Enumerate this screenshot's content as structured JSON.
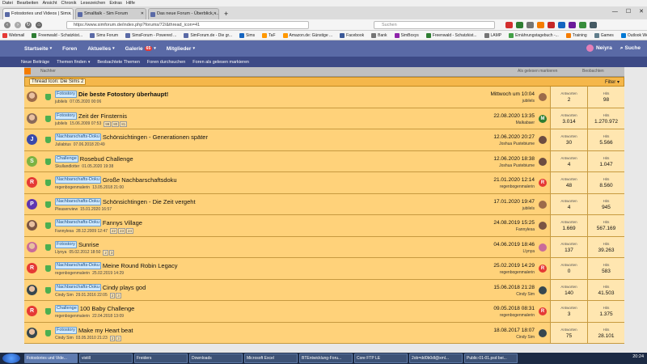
{
  "browser": {
    "menu": [
      "Datei",
      "Bearbeiten",
      "Ansicht",
      "Chronik",
      "Lesezeichen",
      "Extras",
      "Hilfe"
    ],
    "tabs": [
      {
        "label": "Fotostories und Videos | Sim...",
        "favicon_color": "#5a6aa6",
        "active": true
      },
      {
        "label": "Smalltalk - Sim Forum",
        "favicon_color": "#5a6aa6",
        "active": false
      },
      {
        "label": "Das neue Forum - Überblick, ...",
        "favicon_color": "#5a6aa6",
        "active": false
      }
    ],
    "url": "https://www.simforum.de/index.php?forums/72/&thread_icon=41",
    "search_placeholder": "Suchen",
    "addon_colors": [
      "#d32f2f",
      "#2e7d32",
      "#757575",
      "#f57c00",
      "#c62828",
      "#1565c0",
      "#6a1b9a",
      "#388e3c",
      "#455a64"
    ],
    "bookmarks": [
      {
        "label": "Webmail",
        "color": "#e53935"
      },
      {
        "label": "Freenwald - Schatzkist...",
        "color": "#2e7d32"
      },
      {
        "label": "Sims Forum",
        "color": "#5a6aa6"
      },
      {
        "label": "SimsForum - Powered ...",
        "color": "#5a6aa6"
      },
      {
        "label": "SimForum.de - Die gr...",
        "color": "#5a6aa6"
      },
      {
        "label": "Sims",
        "color": "#1565c0"
      },
      {
        "label": "TaF",
        "color": "#ff9800"
      },
      {
        "label": "Amazon.de: Günstige ...",
        "color": "#ff9800"
      },
      {
        "label": "Facebook",
        "color": "#3b5998"
      },
      {
        "label": "Bank",
        "color": "#757575"
      },
      {
        "label": "SimBoxys",
        "color": "#8e24aa"
      },
      {
        "label": "Freenwald - Schatzkist...",
        "color": "#2e7d32"
      },
      {
        "label": "LAMP",
        "color": "#757575"
      },
      {
        "label": "Ernährungstagebuch -...",
        "color": "#43a047"
      },
      {
        "label": "Training",
        "color": "#f57c00"
      },
      {
        "label": "Games",
        "color": "#607d8b"
      },
      {
        "label": "Outlook Web App",
        "color": "#0078d4"
      },
      {
        "label": "iGrad: Cashback, G...",
        "color": "#c62828"
      }
    ]
  },
  "site": {
    "nav": [
      {
        "label": "Startseite",
        "caret": true
      },
      {
        "label": "Foren",
        "caret": false
      },
      {
        "label": "Aktuelles",
        "caret": true
      },
      {
        "label": "Galerie",
        "caret": true,
        "badge": "65"
      },
      {
        "label": "Mitglieder",
        "caret": true
      }
    ],
    "username": "Neiyra",
    "search_label": "Suche",
    "subnav": [
      "Neue Beiträge",
      "Themen finden",
      "Beobachtete Themen",
      "Foren durchsuchen",
      "Foren als gelesen markieren"
    ],
    "partial_top": [
      "Nachher",
      "Als gelesen markieren",
      "Beobachten"
    ],
    "filter": {
      "tag": "Thread Icon: Die Sims 2",
      "label": "Filter"
    }
  },
  "threads": [
    {
      "avatar": "photo",
      "avatar_color": "#9c6b4a",
      "prefix": "Fotostory",
      "title": "Die beste Fotostory überhaupt!",
      "bold": true,
      "author": "jubilels",
      "date": "07.05.2020 00:06",
      "pages": [],
      "last_date": "Mittwoch um 10:04",
      "last_user": "jubilels",
      "last_av_color": "#9c6b4a",
      "replies": "2",
      "views": "98"
    },
    {
      "avatar": "photo",
      "avatar_color": "#8a6a5a",
      "prefix": "Fotostory",
      "title": "Zeit der Finsternis",
      "bold": false,
      "author": "jubilels",
      "date": "15.06.2009 07:53",
      "pages": [
        "99",
        "80",
        "81"
      ],
      "last_date": "22.08.2020 13:35",
      "last_user": "Malkabaer",
      "last_av_color": "#2e7d32",
      "last_av_letter": "M",
      "replies": "3.014",
      "views": "1.270.972"
    },
    {
      "avatar": "J",
      "avatar_color": "#3949ab",
      "prefix": "Nachbarschafts-Doku",
      "title": "Schönsichtingen - Generationen später",
      "bold": false,
      "author": "Juliabtus",
      "date": "07.06.2018 20:49",
      "pages": [],
      "last_date": "12.06.2020 20:27",
      "last_user": "Joshua Pustebiume",
      "last_av_color": "#6d4c41",
      "replies": "30",
      "views": "5.566"
    },
    {
      "avatar": "S",
      "avatar_color": "#7cb342",
      "prefix": "Challenge",
      "title": "Rosebud Challenge",
      "bold": false,
      "author": "Skullandlotter",
      "date": "01.05.2020 19:38",
      "pages": [],
      "last_date": "12.06.2020 18:38",
      "last_user": "Joshua Pustebiume",
      "last_av_color": "#6d4c41",
      "replies": "4",
      "views": "1.047"
    },
    {
      "avatar": "R",
      "avatar_color": "#e53935",
      "prefix": "Nachbarschafts-Doku",
      "title": "Große Nachbarschaftsdoku",
      "bold": false,
      "author": "regenbogenmalerin",
      "date": "13.05.2018 21:00",
      "pages": [],
      "last_date": "21.01.2020 12:14",
      "last_user": "regenbogenmalerin",
      "last_av_color": "#e53935",
      "last_av_letter": "R",
      "replies": "48",
      "views": "8.560"
    },
    {
      "avatar": "P",
      "avatar_color": "#5e35b1",
      "prefix": "Nachbarschafts-Doku",
      "title": "Schönsichtingen - Die Zeit vergeht",
      "bold": false,
      "author": "Pleasenview",
      "date": "15.01.2020 16:57",
      "pages": [],
      "last_date": "17.01.2020 19:47",
      "last_user": "jubilels",
      "last_av_color": "#9c6b4a",
      "replies": "4",
      "views": "945"
    },
    {
      "avatar": "photo",
      "avatar_color": "#7b5544",
      "prefix": "Nachbarschafts-Doku",
      "title": "Fannys Village",
      "bold": false,
      "author": "Fannylesa",
      "date": "28.12.2009 12:47",
      "pages": [
        "22",
        "23",
        "24"
      ],
      "last_date": "24.08.2019 15:25",
      "last_user": "Fannylesa",
      "last_av_color": "#7b5544",
      "replies": "1.669",
      "views": "567.169"
    },
    {
      "avatar": "photo",
      "avatar_color": "#c96b9a",
      "prefix": "Fotostory",
      "title": "Sunrise",
      "bold": false,
      "author": "Llynya",
      "date": "05.02.2012 18:50",
      "pages": [
        "2",
        "3"
      ],
      "last_date": "04.06.2019 18:46",
      "last_user": "Llynya",
      "last_av_color": "#c96b9a",
      "replies": "137",
      "views": "39.263"
    },
    {
      "avatar": "R",
      "avatar_color": "#e53935",
      "prefix": "Nachbarschafts-Doku",
      "title": "Meine Round Robin Legacy",
      "bold": false,
      "author": "regenbogenmalerin",
      "date": "25.02.2019 14:29",
      "pages": [],
      "last_date": "25.02.2019 14:29",
      "last_user": "regenbogenmalerin",
      "last_av_color": "#e53935",
      "last_av_letter": "R",
      "replies": "0",
      "views": "583"
    },
    {
      "avatar": "photo",
      "avatar_color": "#37474f",
      "prefix": "Nachbarschafts-Doku",
      "title": "Cindy plays god",
      "bold": false,
      "author": "Cindy Sim",
      "date": "29.01.2016 22:05",
      "pages": [
        "2",
        "3"
      ],
      "last_date": "15.06.2018 21:28",
      "last_user": "Cindy Sim",
      "last_av_color": "#37474f",
      "replies": "140",
      "views": "41.503"
    },
    {
      "avatar": "R",
      "avatar_color": "#e53935",
      "prefix": "Challenge",
      "title": "100 Baby Challenge",
      "bold": false,
      "author": "regenbogenmalerin",
      "date": "22.04.2018 13:09",
      "pages": [],
      "last_date": "09.05.2018 08:31",
      "last_user": "regenbogenmalerin",
      "last_av_color": "#e53935",
      "last_av_letter": "R",
      "replies": "3",
      "views": "1.375"
    },
    {
      "avatar": "photo",
      "avatar_color": "#37474f",
      "prefix": "Fotostory",
      "title": "Make my Heart beat",
      "bold": false,
      "author": "Cindy Sim",
      "date": "03.05.2010 21:23",
      "pages": [
        "2",
        "3"
      ],
      "last_date": "18.08.2017 18:07",
      "last_user": "Cindy Sim",
      "last_av_color": "#37474f",
      "replies": "75",
      "views": "28.101"
    }
  ],
  "stat_labels": {
    "replies": "Antworten",
    "views": "Hits"
  },
  "taskbar": {
    "items": [
      {
        "label": "Fotostories und Vide...",
        "active": true
      },
      {
        "label": "vistill",
        "active": false
      },
      {
        "label": "Freiders",
        "active": false
      },
      {
        "label": "Downloads",
        "active": false
      },
      {
        "label": "Microsoft Excel",
        "active": false
      },
      {
        "label": "BTEntwicklung-Foru...",
        "active": false
      },
      {
        "label": "Core FTP LE",
        "active": false
      },
      {
        "label": "2ob=dd0b0dl@xml...",
        "active": false
      },
      {
        "label": "Public-01-01.psd bei...",
        "active": false
      }
    ],
    "clock": "20:24"
  }
}
